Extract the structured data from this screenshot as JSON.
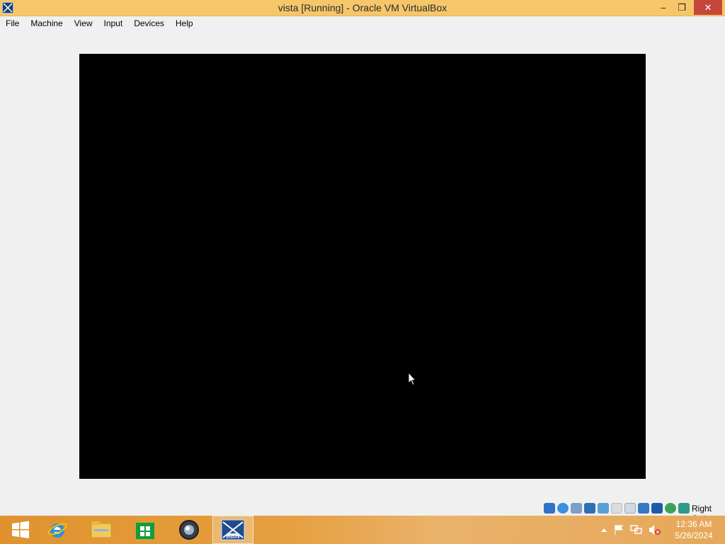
{
  "window": {
    "title": "vista [Running] - Oracle VM VirtualBox",
    "controls": {
      "minimize": "–",
      "maximize": "❐",
      "close": "✕"
    }
  },
  "menubar": {
    "items": [
      "File",
      "Machine",
      "View",
      "Input",
      "Devices",
      "Help"
    ]
  },
  "status_bar": {
    "icons": [
      "hard-disk-icon",
      "optical-drive-icon",
      "audio-icon",
      "network-icon",
      "usb-icon",
      "shared-folders-icon",
      "display-icon",
      "video-capture-icon",
      "vt-x-icon",
      "mouse-integration-icon",
      "keyboard-icon"
    ],
    "host_key": "Right Ctrl"
  },
  "taskbar": {
    "apps": [
      "start-icon",
      "internet-explorer-icon",
      "file-explorer-icon",
      "store-icon",
      "media-center-icon",
      "virtualbox-vista-icon"
    ],
    "active_app_label": "vista",
    "clock_time": "12:36 AM",
    "clock_date": "5/26/2024"
  },
  "colors": {
    "titlebar": "#f6c76a",
    "close_button": "#c7463c",
    "taskbar": "#e39a36",
    "guest_screen": "#000000"
  }
}
